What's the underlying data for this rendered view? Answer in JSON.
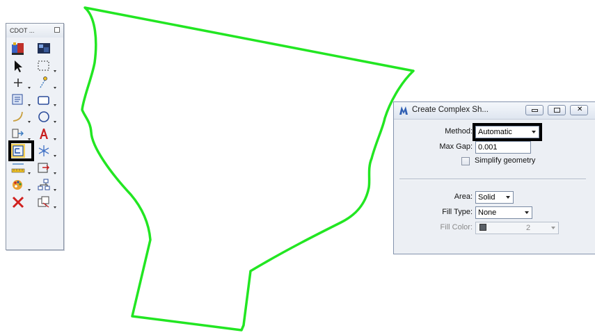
{
  "palette": {
    "title": "CDOT ...",
    "tools": [
      {
        "name": "seed-tool-icon",
        "interactable": true,
        "arrow": false
      },
      {
        "name": "view-tool-icon",
        "interactable": true,
        "arrow": false
      },
      {
        "name": "select-arrow-icon",
        "interactable": true,
        "arrow": false
      },
      {
        "name": "selection-box-icon",
        "interactable": true,
        "arrow": true
      },
      {
        "name": "place-line-cross-icon",
        "interactable": true,
        "arrow": true
      },
      {
        "name": "place-point-icon",
        "interactable": true,
        "arrow": true
      },
      {
        "name": "fence-icon",
        "interactable": true,
        "arrow": true
      },
      {
        "name": "rectangle-icon",
        "interactable": true,
        "arrow": true
      },
      {
        "name": "arc-icon",
        "interactable": true,
        "arrow": true
      },
      {
        "name": "circle-icon",
        "interactable": true,
        "arrow": true
      },
      {
        "name": "cell-icon",
        "interactable": true,
        "arrow": true
      },
      {
        "name": "text-icon",
        "interactable": true,
        "arrow": true
      },
      {
        "name": "create-complex-shape-icon",
        "interactable": true,
        "arrow": false,
        "selected": true
      },
      {
        "name": "snowflake-icon",
        "interactable": true,
        "arrow": true
      },
      {
        "name": "measure-icon",
        "interactable": true,
        "arrow": true
      },
      {
        "name": "move-icon",
        "interactable": true,
        "arrow": true
      },
      {
        "name": "palette-icon",
        "interactable": true,
        "arrow": true
      },
      {
        "name": "hierarchy-icon",
        "interactable": true,
        "arrow": true
      },
      {
        "name": "delete-x-icon",
        "interactable": true,
        "arrow": false
      },
      {
        "name": "copy-icon",
        "interactable": true,
        "arrow": true
      }
    ]
  },
  "dialog": {
    "title": "Create Complex Sh...",
    "method": {
      "label": "Method:",
      "value": "Automatic"
    },
    "max_gap": {
      "label": "Max Gap:",
      "value": "0.001"
    },
    "simplify": {
      "label": "Simplify geometry",
      "checked": false
    },
    "area": {
      "label": "Area:",
      "value": "Solid"
    },
    "fill_type": {
      "label": "Fill Type:",
      "value": "None"
    },
    "fill_color": {
      "label": "Fill Color:",
      "value": "2"
    }
  },
  "colors": {
    "shape_outline": "#22e622",
    "highlight": "#000000"
  }
}
